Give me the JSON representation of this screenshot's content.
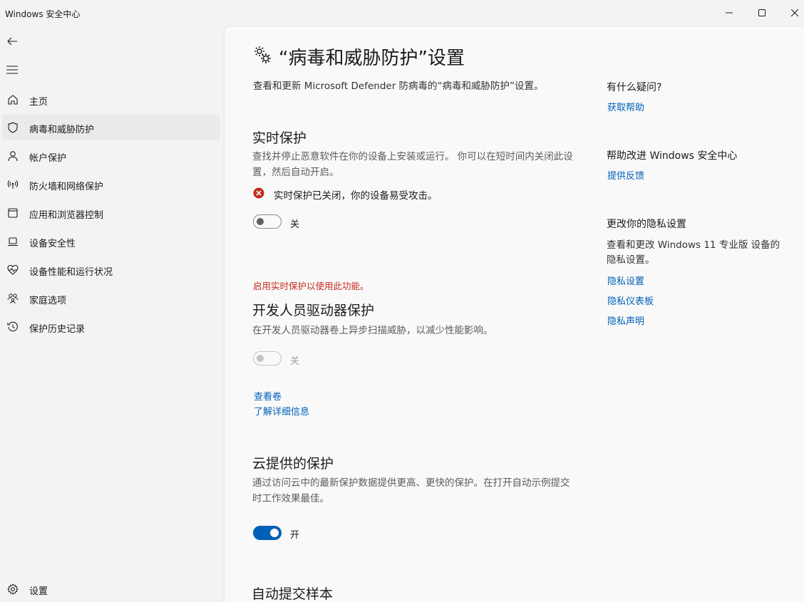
{
  "window": {
    "title": "Windows 安全中心"
  },
  "sidebar": {
    "items": [
      {
        "label": "主页",
        "icon": "home-icon"
      },
      {
        "label": "病毒和威胁防护",
        "icon": "shield-icon"
      },
      {
        "label": "帐户保护",
        "icon": "person-icon"
      },
      {
        "label": "防火墙和网络保护",
        "icon": "antenna-icon"
      },
      {
        "label": "应用和浏览器控制",
        "icon": "app-window-icon"
      },
      {
        "label": "设备安全性",
        "icon": "laptop-icon"
      },
      {
        "label": "设备性能和运行状况",
        "icon": "heart-pulse-icon"
      },
      {
        "label": "家庭选项",
        "icon": "family-icon"
      },
      {
        "label": "保护历史记录",
        "icon": "history-icon"
      }
    ],
    "active_index": 1,
    "settings_label": "设置"
  },
  "main": {
    "title": "“病毒和威胁防护”设置",
    "description": "查看和更新 Microsoft Defender 防病毒的“病毒和威胁防护”设置。",
    "realtime": {
      "title": "实时保护",
      "description": "查找并停止恶意软件在你的设备上安装或运行。 你可以在短时间内关闭此设置，然后自动开启。",
      "warning": "实时保护已关闭，你的设备易受攻击。",
      "toggle_label": "关",
      "state": "off"
    },
    "dev_drive": {
      "note": "启用实时保护以使用此功能。",
      "title": "开发人员驱动器保护",
      "description": "在开发人员驱动器卷上异步扫描威胁，以减少性能影响。",
      "toggle_label": "关",
      "state": "disabled",
      "link_volumes": "查看卷",
      "link_learn_more": "了解详细信息"
    },
    "cloud": {
      "title": "云提供的保护",
      "description": "通过访问云中的最新保护数据提供更高、更快的保护。在打开自动示例提交时工作效果最佳。",
      "toggle_label": "开",
      "state": "on"
    },
    "auto_sample": {
      "title": "自动提交样本"
    }
  },
  "aside": {
    "question_title": "有什么疑问?",
    "get_help": "获取帮助",
    "improve_title": "帮助改进 Windows 安全中心",
    "feedback": "提供反馈",
    "privacy_title": "更改你的隐私设置",
    "privacy_desc": "查看和更改 Windows 11 专业版 设备的隐私设置。",
    "privacy_settings": "隐私设置",
    "privacy_dashboard": "隐私仪表板",
    "privacy_statement": "隐私声明"
  },
  "colors": {
    "accent": "#005fb8",
    "error": "#c42b1c"
  }
}
